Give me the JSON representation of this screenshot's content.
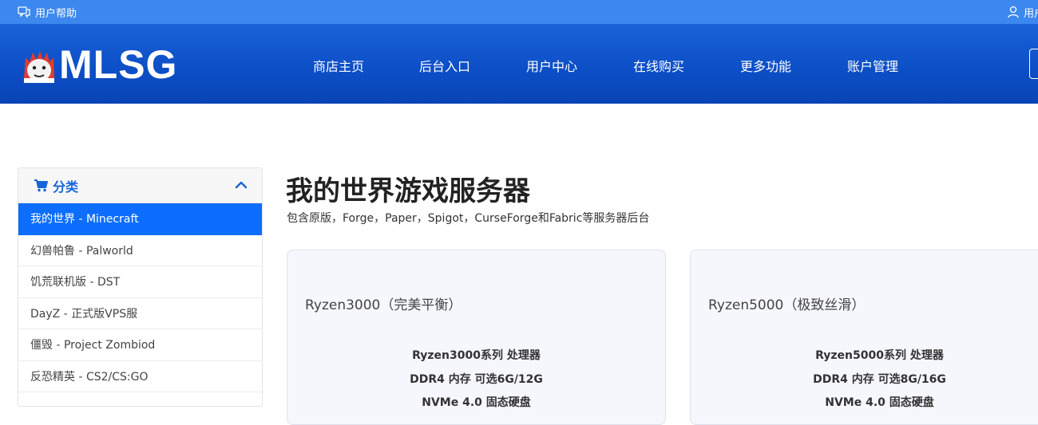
{
  "topbar": {
    "help_label": "用户帮助",
    "user_label": "用户"
  },
  "header": {
    "logo_text": "MLSG",
    "nav": [
      "商店主页",
      "后台入口",
      "用户中心",
      "在线购买",
      "更多功能",
      "账户管理"
    ]
  },
  "sidebar": {
    "header_label": "分类",
    "items": [
      "我的世界 - Minecraft",
      "幻兽帕鲁 - Palworld",
      "饥荒联机版 - DST",
      "DayZ - 正式版VPS服",
      "僵毁 - Project Zombiod",
      "反恐精英 - CS2/CS:GO"
    ],
    "active_index": 0
  },
  "main": {
    "title": "我的世界游戏服务器",
    "subtitle": "包含原版，Forge，Paper，Spigot，CurseForge和Fabric等服务器后台"
  },
  "cards": [
    {
      "title": "Ryzen3000（完美平衡）",
      "specs": [
        "Ryzen3000系列 处理器",
        "DDR4 内存 可选6G/12G",
        "NVMe 4.0 固态硬盘"
      ]
    },
    {
      "title": "Ryzen5000（极致丝滑）",
      "specs": [
        "Ryzen5000系列 处理器",
        "DDR4 内存 可选8G/16G",
        "NVMe 4.0 固态硬盘"
      ]
    }
  ],
  "colors": {
    "topbar": "#3d88ee",
    "header": "#0d4fc7",
    "accent": "#0d6efd",
    "card_bg": "#f6f7fd"
  },
  "icons": {
    "help": "chat-bubbles-icon",
    "user": "user-icon",
    "category": "cart-icon",
    "collapse": "chevron-up-icon"
  }
}
